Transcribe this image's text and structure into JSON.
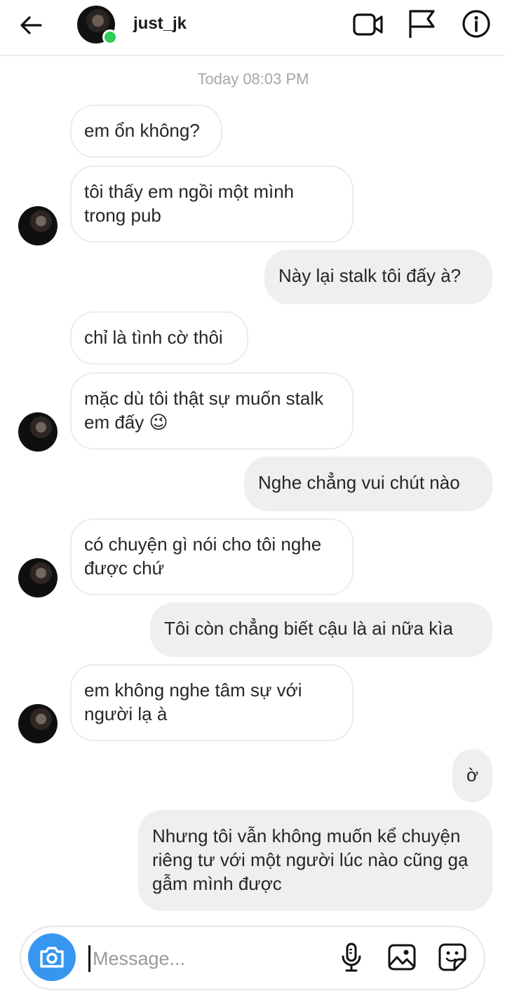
{
  "header": {
    "back_icon": "arrow-left-icon",
    "username": "just_jk",
    "online": true,
    "icons": [
      "video-camera-icon",
      "flag-icon",
      "info-icon"
    ]
  },
  "timestamp": "Today 08:03 PM",
  "messages": [
    {
      "from": "them",
      "text": "em ổn không?"
    },
    {
      "from": "them",
      "text": "tôi thấy em ngồi một mình trong pub"
    },
    {
      "from": "me",
      "text": "Này lại stalk tôi đấy à?"
    },
    {
      "from": "them",
      "text": "chỉ là tình cờ thôi"
    },
    {
      "from": "them",
      "text": "mặc dù tôi thật sự muốn stalk em đấy",
      "emoji": "😉"
    },
    {
      "from": "me",
      "text": "Nghe chẳng vui chút nào"
    },
    {
      "from": "them",
      "text": "có chuyện gì nói cho tôi nghe được chứ"
    },
    {
      "from": "me",
      "text": "Tôi còn chẳng biết cậu là ai nữa kìa"
    },
    {
      "from": "them",
      "text": "em không nghe tâm sự với người lạ à"
    },
    {
      "from": "me",
      "text": "ờ"
    },
    {
      "from": "me",
      "text": "Nhưng tôi vẫn không muốn kể chuyện riêng tư với một người lúc nào cũng gạ gẫm mình được"
    }
  ],
  "composer": {
    "placeholder": "Message...",
    "value": "",
    "icons": [
      "camera-icon",
      "microphone-icon",
      "gallery-icon",
      "sticker-icon"
    ]
  },
  "colors": {
    "accent": "#3797f0",
    "online": "#2ecc58",
    "outgoing_bubble": "#efefef",
    "incoming_border": "#ececec"
  }
}
